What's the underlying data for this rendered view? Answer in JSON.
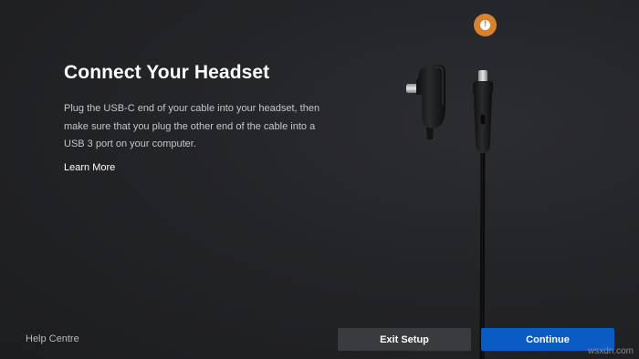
{
  "page": {
    "title": "Connect Your Headset",
    "description": "Plug the USB-C end of your cable into your headset, then make sure that you plug the other end of the cable into a USB 3 port on your computer.",
    "learn_more_label": "Learn More"
  },
  "alert": {
    "icon": "exclamation-icon",
    "glyph": "!",
    "color": "#d9822b"
  },
  "footer": {
    "help_label": "Help Centre",
    "exit_label": "Exit Setup",
    "continue_label": "Continue",
    "continue_color": "#0a5bc4"
  },
  "illustration": {
    "subject": "usb-c-cable-ends"
  },
  "watermark": {
    "text": "wsxdn.com"
  }
}
